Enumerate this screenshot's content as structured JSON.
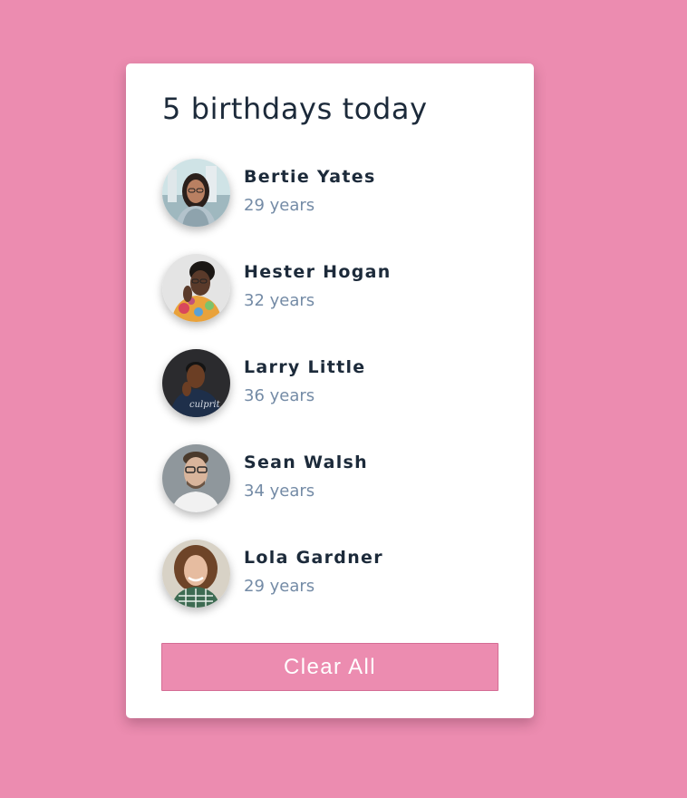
{
  "title": "5 birthdays today",
  "people": [
    {
      "name": "Bertie Yates",
      "age": "29 years",
      "photo_icon": "woman-with-glasses-photo"
    },
    {
      "name": "Hester Hogan",
      "age": "32 years",
      "photo_icon": "woman-in-floral-shirt-photo"
    },
    {
      "name": "Larry Little",
      "age": "36 years",
      "photo_icon": "man-in-dark-shirt-photo"
    },
    {
      "name": "Sean Walsh",
      "age": "34 years",
      "photo_icon": "man-with-glasses-photo"
    },
    {
      "name": "Lola Gardner",
      "age": "29 years",
      "photo_icon": "woman-with-curly-hair-photo"
    }
  ],
  "clear_button": {
    "label": "Clear All"
  },
  "colors": {
    "background": "#ec8cb0",
    "card": "#ffffff",
    "text_dark": "#1c2a3a",
    "text_muted": "#748ba6",
    "button": "#ec8cb0"
  }
}
